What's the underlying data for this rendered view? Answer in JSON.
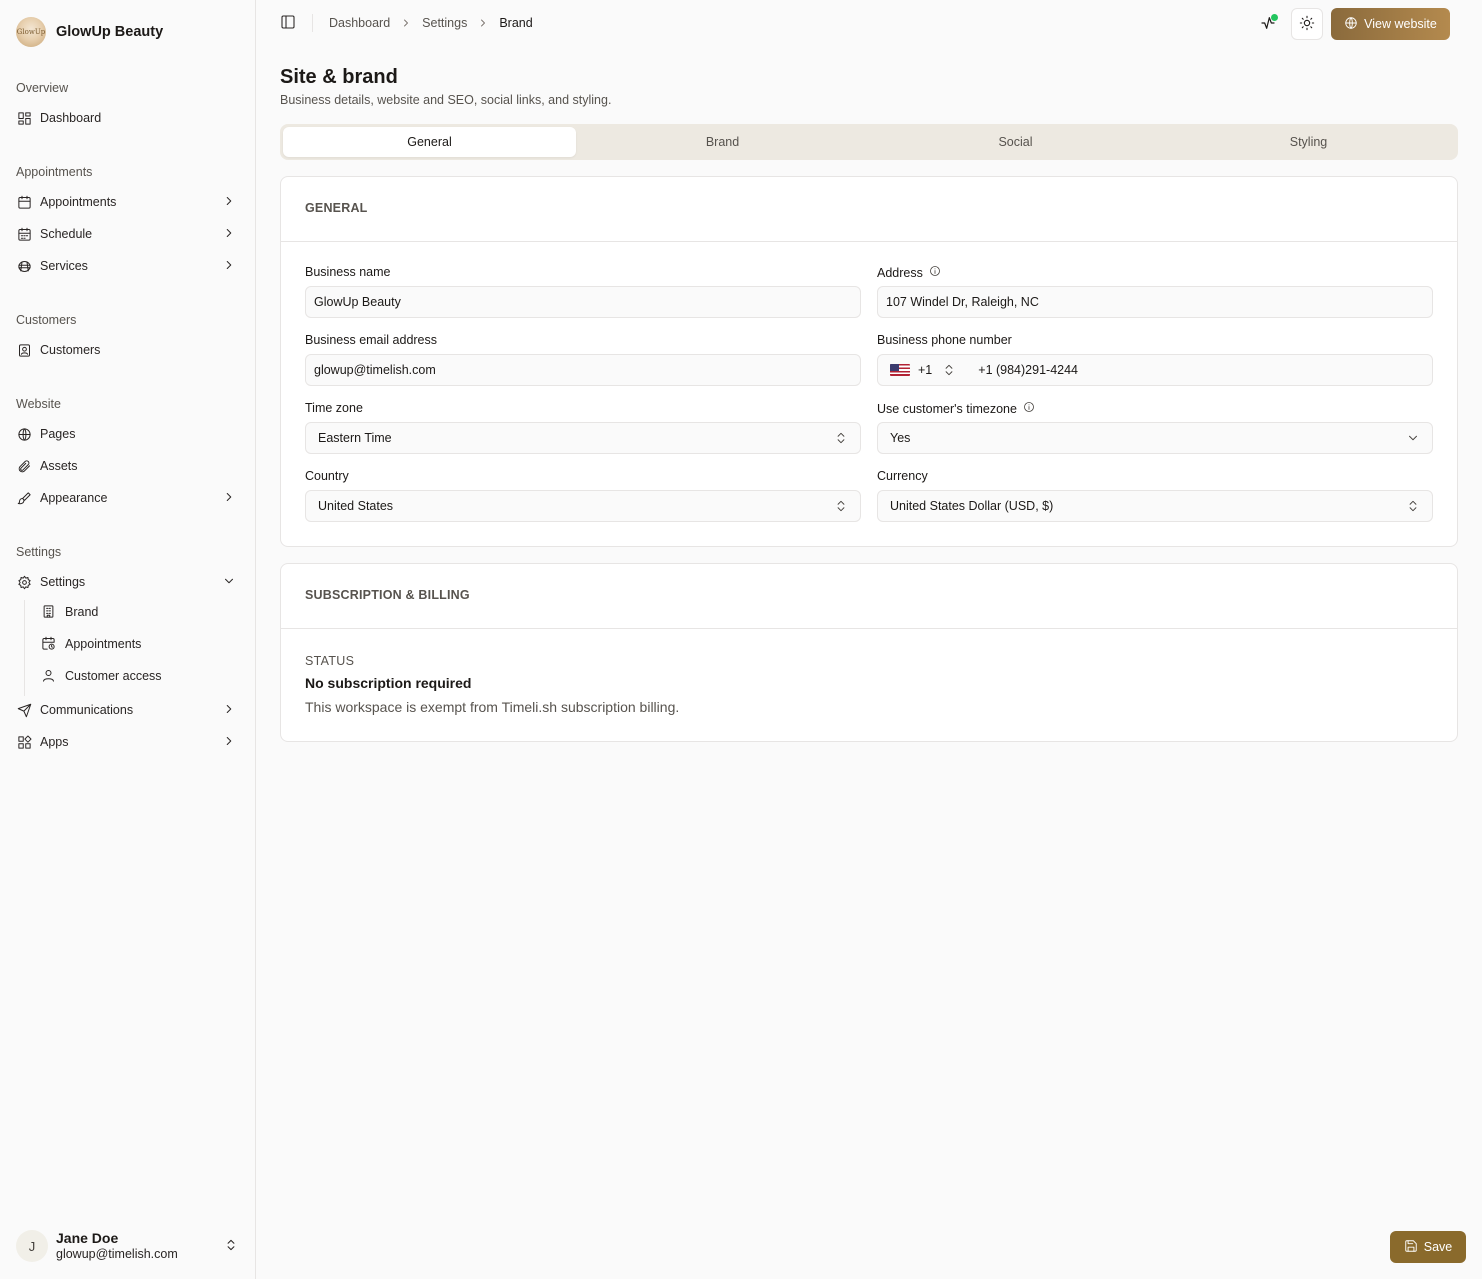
{
  "brand": {
    "name": "GlowUp Beauty",
    "logo_text": "GlowUp"
  },
  "sidebar": {
    "groups": {
      "overview": "Overview",
      "appointments": "Appointments",
      "customers": "Customers",
      "website": "Website",
      "settings": "Settings"
    },
    "items": {
      "dashboard": "Dashboard",
      "appointments": "Appointments",
      "schedule": "Schedule",
      "services": "Services",
      "customers": "Customers",
      "pages": "Pages",
      "assets": "Assets",
      "appearance": "Appearance",
      "settings": "Settings",
      "communications": "Communications",
      "apps": "Apps"
    },
    "settings_sub": {
      "brand": "Brand",
      "appointments": "Appointments",
      "customer_access": "Customer access"
    },
    "user": {
      "initial": "J",
      "name": "Jane Doe",
      "email": "glowup@timelish.com"
    }
  },
  "topbar": {
    "breadcrumbs": [
      "Dashboard",
      "Settings",
      "Brand"
    ],
    "view_website_label": "View website",
    "activity_status_color": "#22c55e"
  },
  "page": {
    "title": "Site & brand",
    "subtitle": "Business details, website and SEO, social links, and styling."
  },
  "tabs": [
    {
      "label": "General",
      "active": true
    },
    {
      "label": "Brand",
      "active": false
    },
    {
      "label": "Social",
      "active": false
    },
    {
      "label": "Styling",
      "active": false
    }
  ],
  "general": {
    "section_title": "GENERAL",
    "fields": {
      "business_name": {
        "label": "Business name",
        "value": "GlowUp Beauty"
      },
      "address": {
        "label": "Address",
        "value": "107 Windel Dr, Raleigh, NC"
      },
      "email": {
        "label": "Business email address",
        "value": "glowup@timelish.com"
      },
      "phone": {
        "label": "Business phone number",
        "country_code": "+1",
        "value": "+1 (984)291-4244"
      },
      "timezone": {
        "label": "Time zone",
        "value": "Eastern Time"
      },
      "use_customer_tz": {
        "label": "Use customer's timezone",
        "value": "Yes"
      },
      "country": {
        "label": "Country",
        "value": "United States"
      },
      "currency": {
        "label": "Currency",
        "value": "United States Dollar (USD, $)"
      }
    }
  },
  "billing": {
    "section_title": "SUBSCRIPTION & BILLING",
    "status_label": "STATUS",
    "status_value": "No subscription required",
    "status_desc": "This workspace is exempt from Timeli.sh subscription billing."
  },
  "actions": {
    "save_label": "Save"
  },
  "colors": {
    "accent": "#8a6a2c",
    "tab_track": "#ede9e1"
  }
}
